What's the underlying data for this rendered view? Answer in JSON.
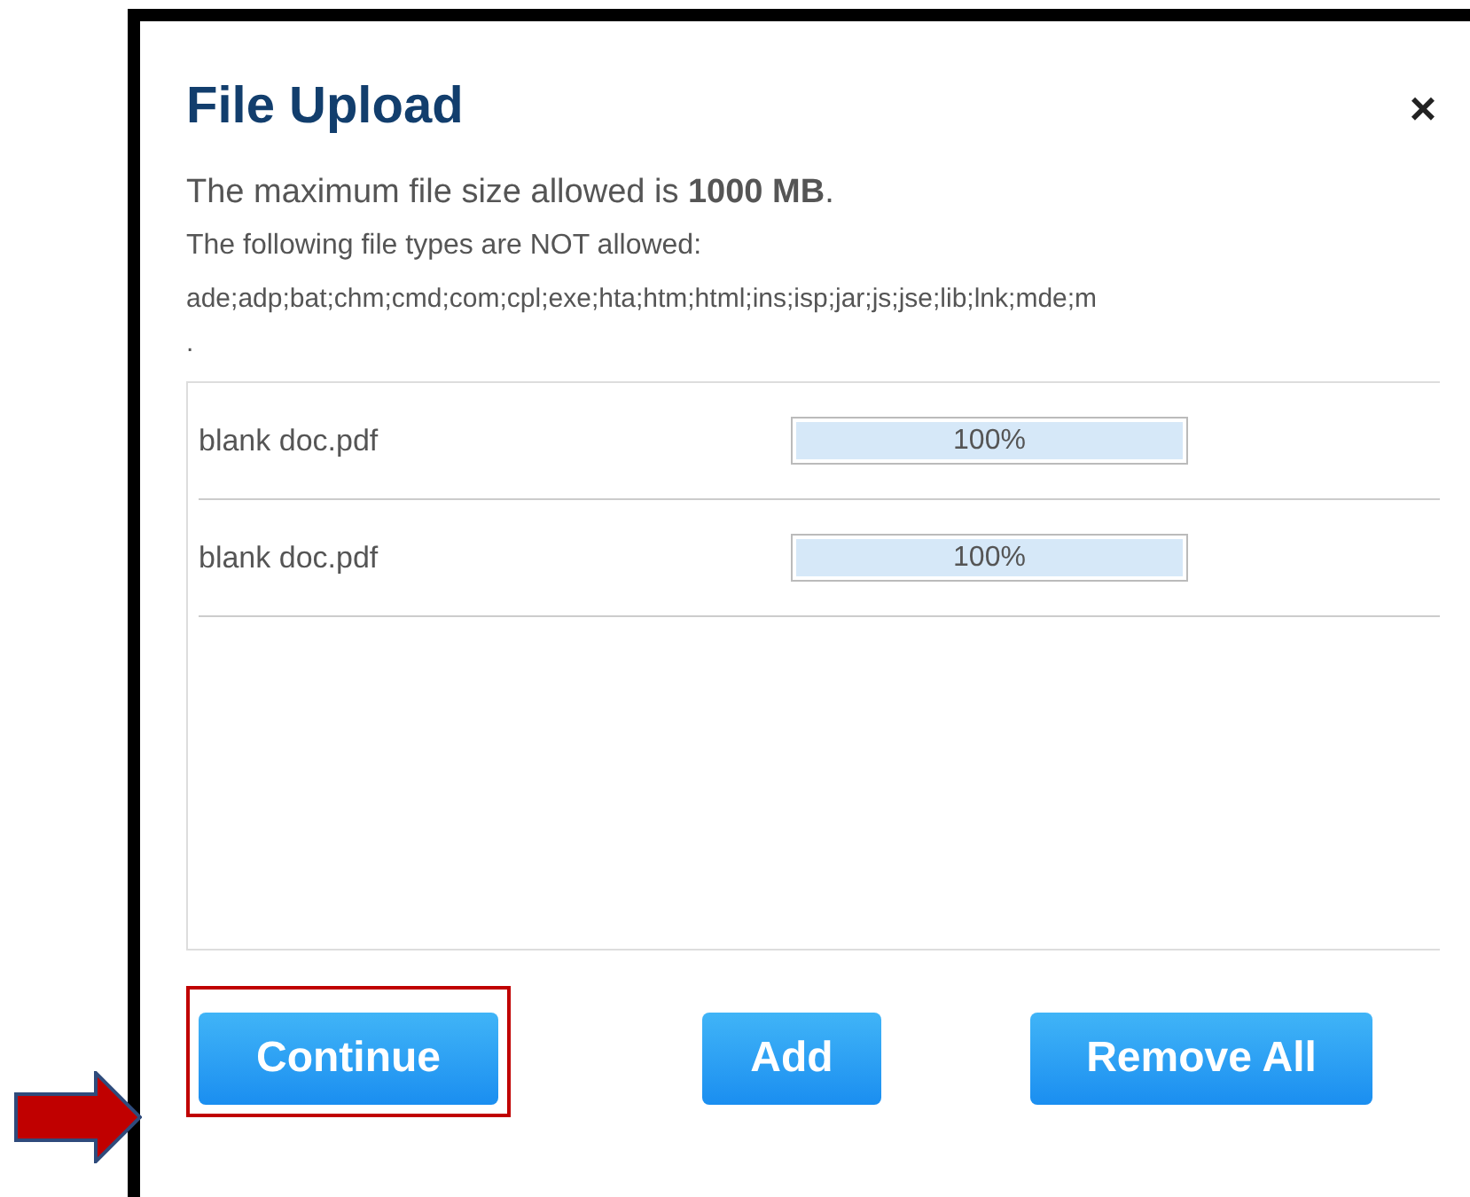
{
  "dialog": {
    "title": "File Upload",
    "close": "×",
    "max_size_text": "The maximum file size allowed is **1000 MB**.",
    "types_label": "The following file types are NOT allowed:",
    "types_list": "ade;adp;bat;chm;cmd;com;cpl;exe;hta;htm;html;ins;isp;jar;js;jse;lib;lnk;mde;m",
    "types_end": "."
  },
  "files": [
    {
      "name": "blank doc.pdf",
      "level": 1,
      "reading": "100%"
    },
    {
      "name": "blank doc.pdf",
      "level": 1,
      "reading": "100%"
    }
  ],
  "buttons": [
    {
      "label": "Continue",
      "highlighted": true
    },
    {
      "label": "Add",
      "highlighted": false
    },
    {
      "label": "Remove All",
      "highlighted": false
    }
  ]
}
